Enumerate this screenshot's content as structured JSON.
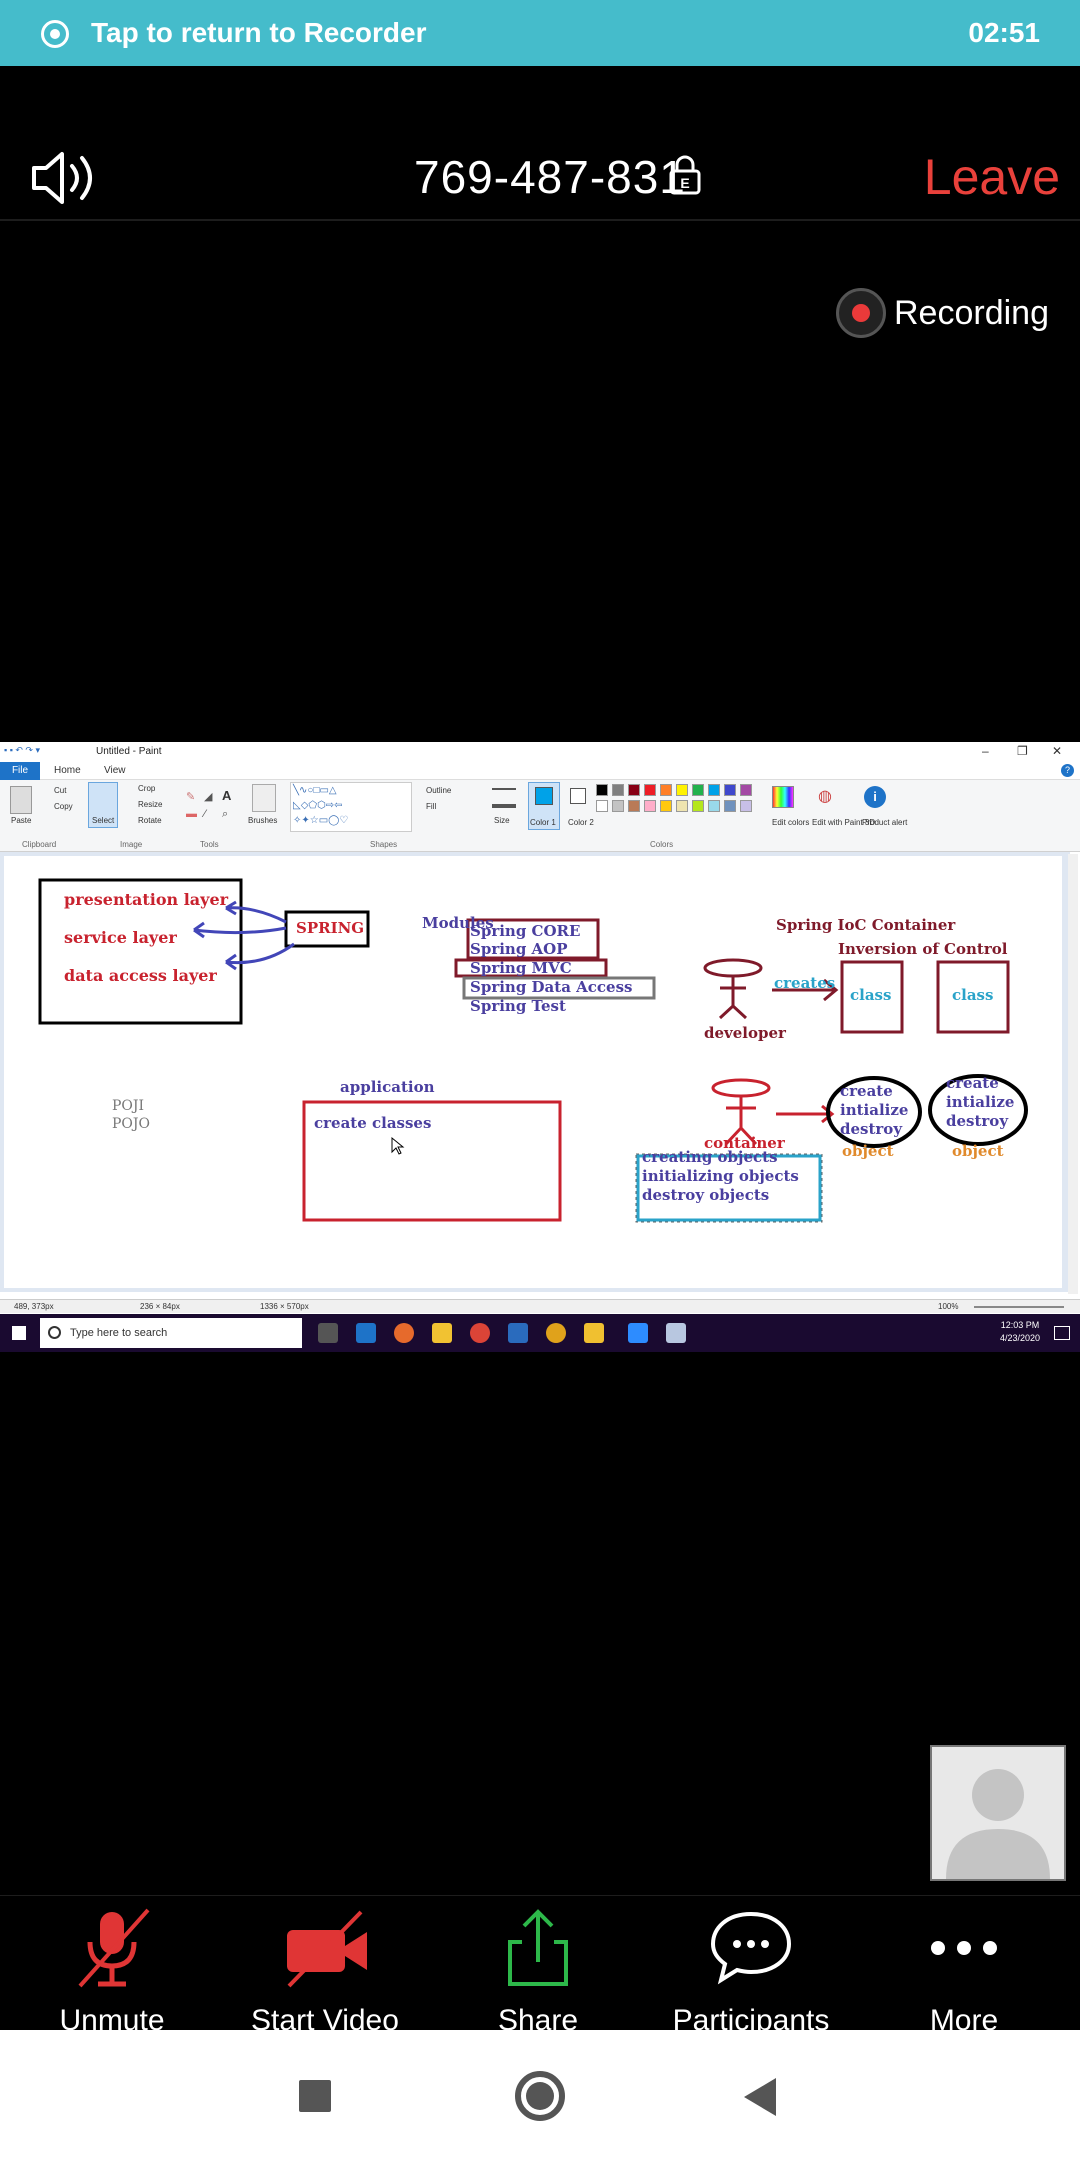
{
  "recorder_banner": {
    "text": "Tap to return to Recorder",
    "timer": "02:51"
  },
  "meeting": {
    "id": "769-487-831",
    "leave_label": "Leave",
    "recording_label": "Recording"
  },
  "paint": {
    "title": "Untitled - Paint",
    "tabs": {
      "file": "File",
      "home": "Home",
      "view": "View"
    },
    "ribbon": {
      "paste": "Paste",
      "cut": "Cut",
      "copy": "Copy",
      "select": "Select",
      "crop": "Crop",
      "resize": "Resize",
      "rotate": "Rotate",
      "brushes": "Brushes",
      "outline": "Outline",
      "fill": "Fill",
      "size": "Size",
      "color1": "Color 1",
      "color2": "Color 2",
      "edit_colors": "Edit colors",
      "edit_paint3d": "Edit with Paint 3D",
      "product_alert": "Product alert",
      "groups": {
        "clipboard": "Clipboard",
        "image": "Image",
        "tools": "Tools",
        "shapes": "Shapes",
        "colors": "Colors"
      }
    },
    "palette": [
      "#000000",
      "#7f7f7f",
      "#880015",
      "#ed1c24",
      "#ff7f27",
      "#fff200",
      "#22b14c",
      "#00a2e8",
      "#3f48cc",
      "#a349a4",
      "#ffffff",
      "#c3c3c3",
      "#b97a57",
      "#ffaec9",
      "#ffc90e",
      "#efe4b0",
      "#b5e61d",
      "#99d9ea",
      "#7092be",
      "#c8bfe7"
    ],
    "status": {
      "cursor": "489, 373px",
      "selection": "236 × 84px",
      "canvas_size": "1336 × 570px",
      "zoom": "100%"
    },
    "taskbar": {
      "search_placeholder": "Type here to search",
      "time": "12:03 PM",
      "date": "4/23/2020"
    }
  },
  "drawing": {
    "layers": [
      "presentation layer",
      "service  layer",
      "data access layer"
    ],
    "spring": "SPRING",
    "modules_title": "Modules",
    "modules": [
      "Spring  CORE",
      "Spring  AOP",
      "Spring  MVC",
      "Spring  Data Access",
      "Spring  Test"
    ],
    "ioc_title": "Spring IoC  Container",
    "ioc_subtitle": "Inversion of Control",
    "creates": "creates",
    "class1": "class",
    "class2": "class",
    "developer": "developer",
    "container": "container",
    "create_ops": [
      "create",
      "intialize",
      "destroy"
    ],
    "object1": "object",
    "object2": "object",
    "poji": "POJI",
    "pojo": "POJO",
    "application": "application",
    "create_classes": "create classes",
    "container_ops": [
      "creating objects",
      "initializing objects",
      "destroy objects"
    ]
  },
  "bottom_bar": {
    "unmute": "Unmute",
    "start_video": "Start Video",
    "share": "Share",
    "participants": "Participants",
    "more": "More"
  },
  "colors": {
    "banner": "#45bccb",
    "leave": "#e9413b",
    "recording_dot": "#ea3a3a",
    "share_green": "#2db84a",
    "muted_red": "#e03535"
  }
}
